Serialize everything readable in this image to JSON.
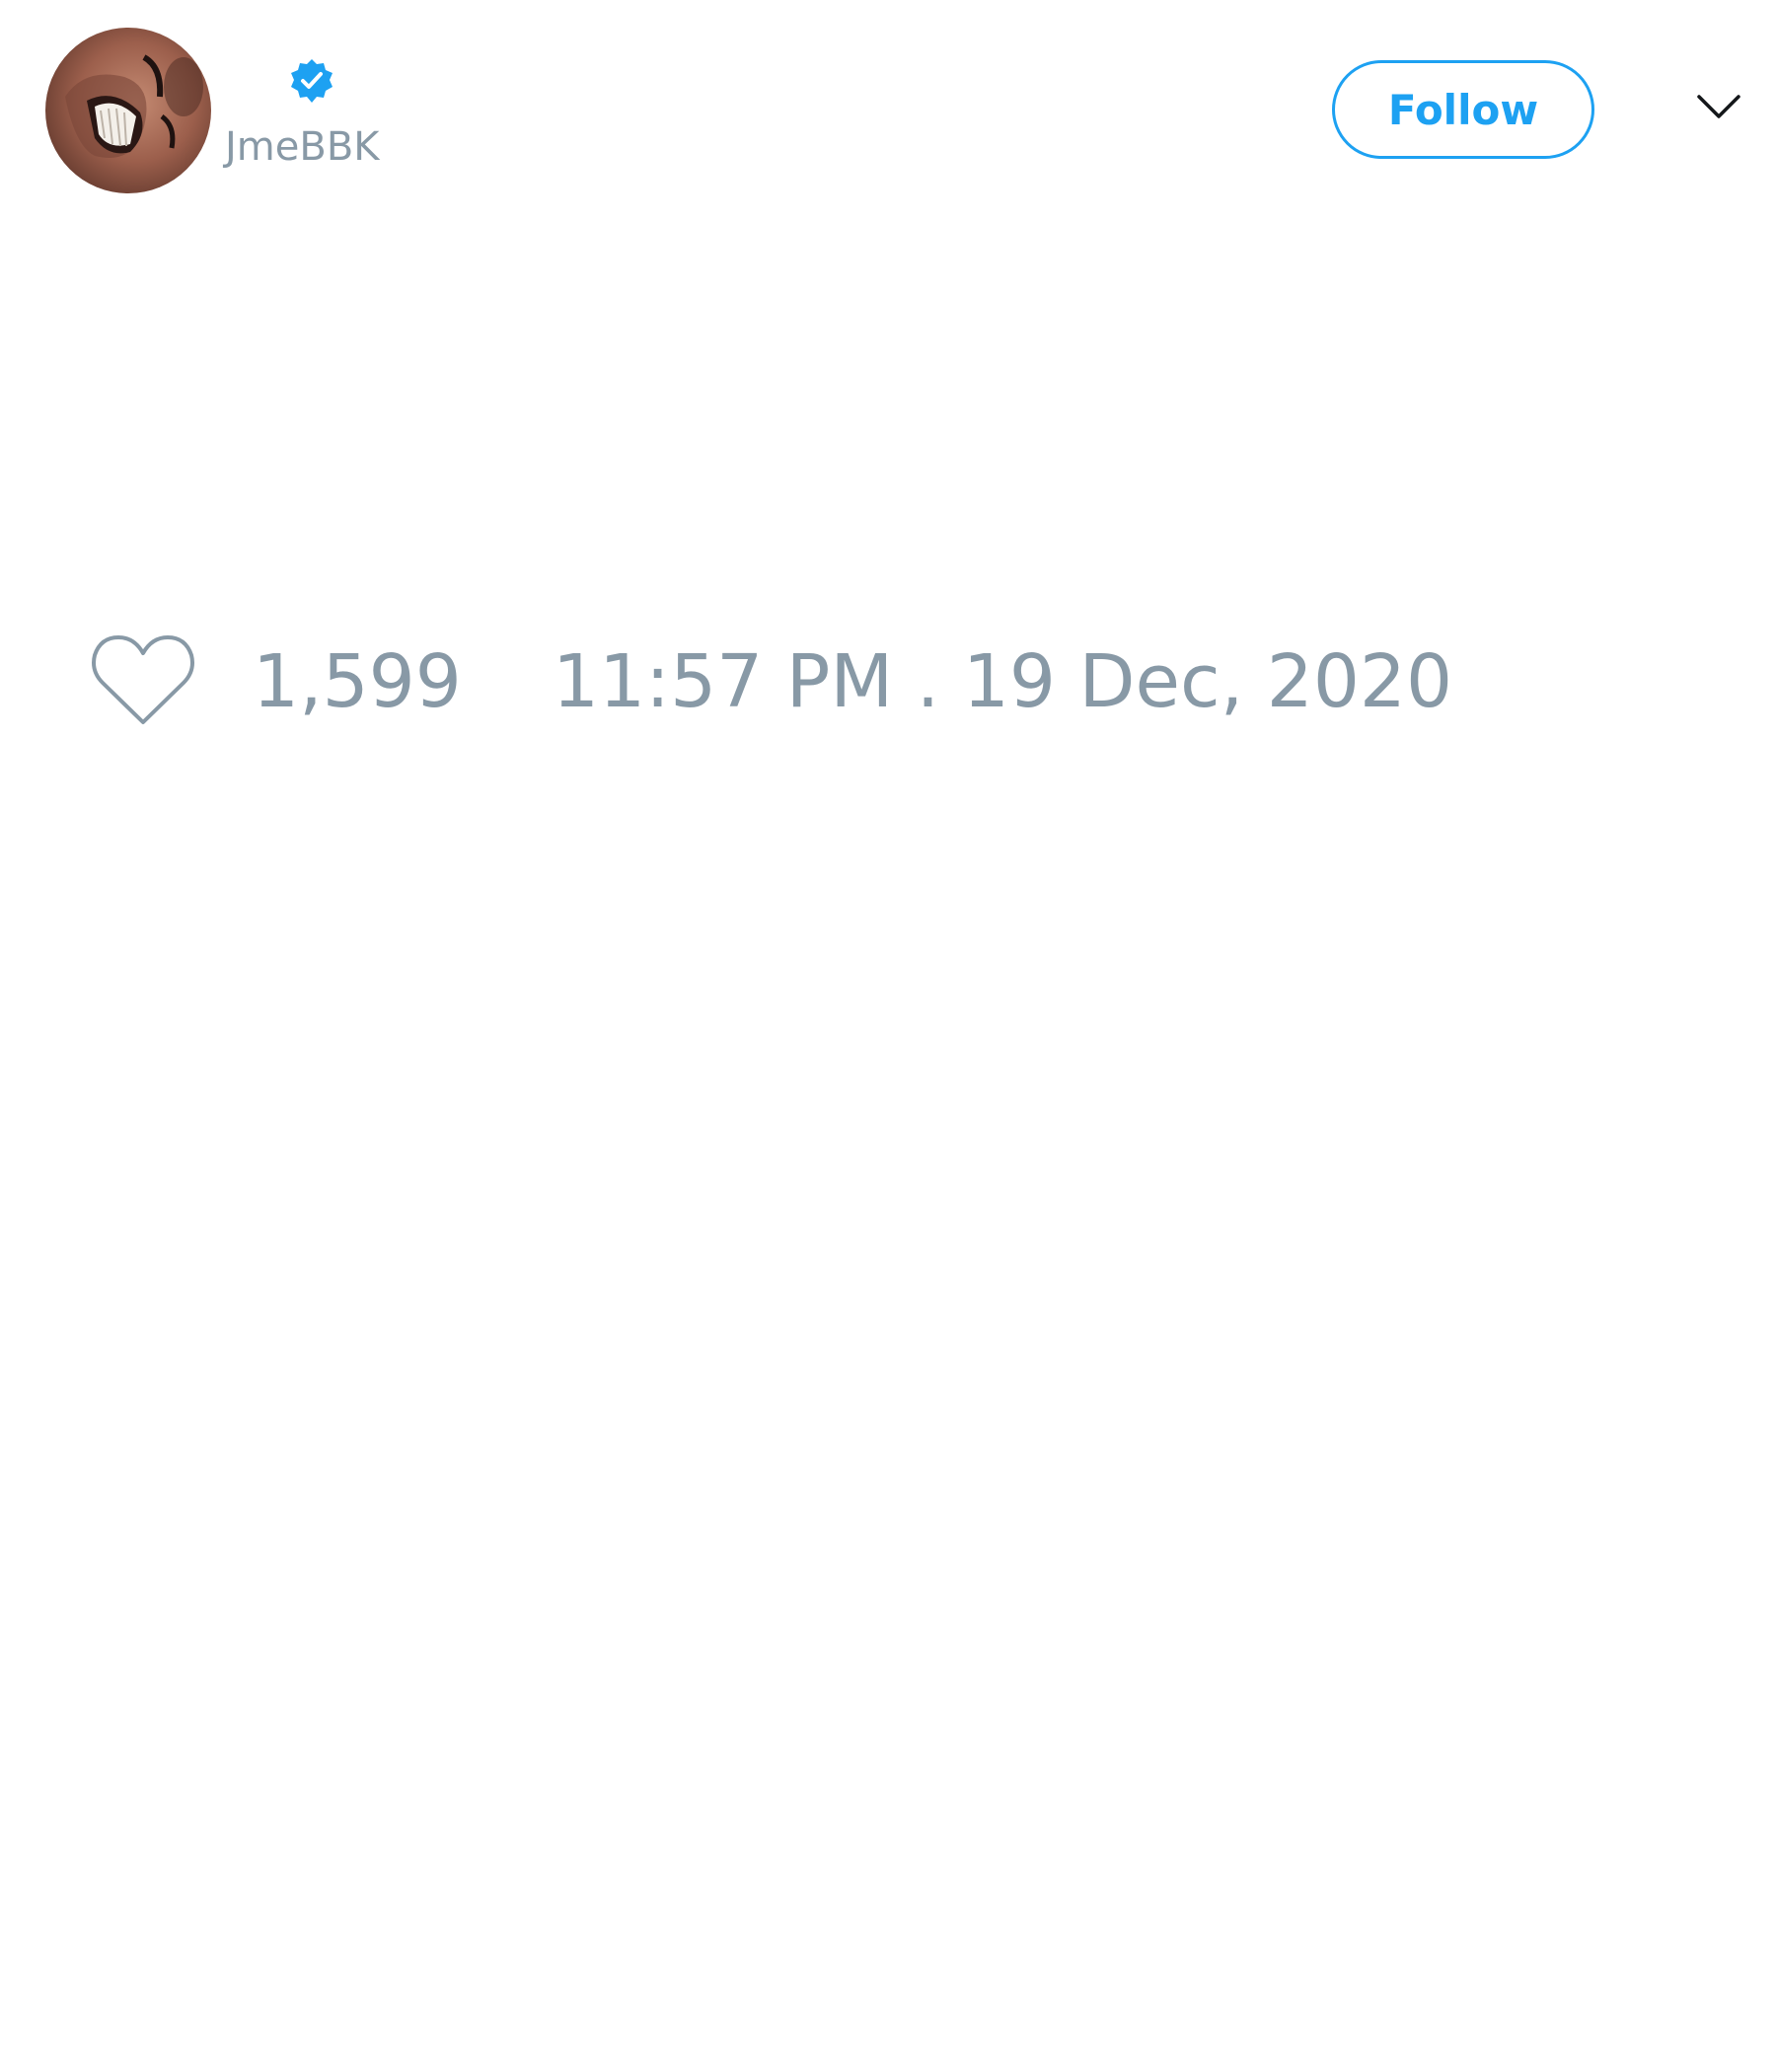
{
  "header": {
    "display_name": "",
    "username": "JmeBBK",
    "verified": true,
    "follow_label": "Follow",
    "menu_icon": "chevron-down-icon"
  },
  "footer": {
    "like_icon": "heart-icon",
    "like_count": "1,599",
    "timestamp": "11:57 PM . 19 Dec, 2020"
  },
  "colors": {
    "accent": "#1da1f2",
    "muted": "#8899a6",
    "background": "#ffffff"
  }
}
